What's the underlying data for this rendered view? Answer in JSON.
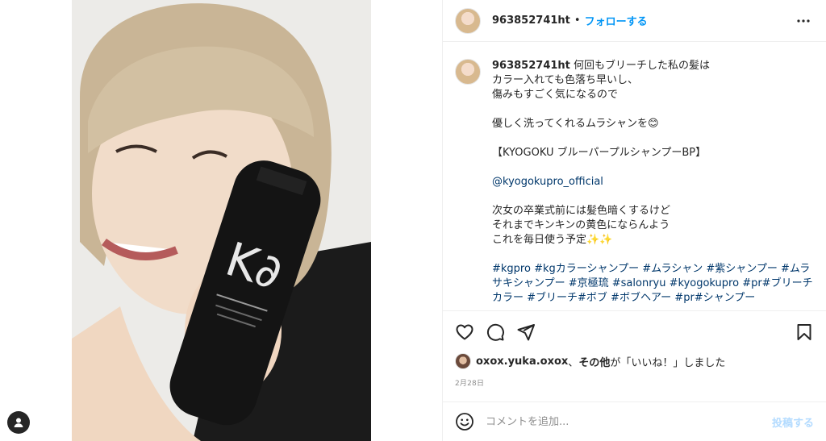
{
  "post": {
    "username": "963852741ht",
    "separator": "•",
    "follow_label": "フォローする",
    "caption": {
      "username": "963852741ht",
      "lines_1": "何回もブリーチした私の髪は\nカラー入れても色落ち早いし、\n傷みもすごく気になるので",
      "lines_2": "優しく洗ってくれるムラシャンを😊",
      "lines_3": "【KYOGOKU ブルーパープルシャンプーBP】",
      "mention": "@kyogokupro_official",
      "lines_4": "次女の卒業式前には髪色暗くするけど\nそれまでキンキンの黄色にならんよう\nこれを毎日使う予定✨✨",
      "hashtags": "#kgpro #kgカラーシャンプー #ムラシャン #紫シャンプー #ムラサキシャンプー #京極琉 #salonryu #kyogokupro #pr#ブリーチカラー #ブリーチ#ボブ #ボブヘアー #pr#シャンプー"
    },
    "likes": {
      "liker": "oxox.yuka.oxox",
      "sep": "、",
      "others": "その他",
      "suffix": "が「いいね！」しました"
    },
    "date": "2月28日",
    "comment_placeholder": "コメントを追加...",
    "post_button": "投稿する"
  },
  "product_label": "K∂",
  "icons": {
    "more": "more-horizontal-icon",
    "like": "heart-icon",
    "comment": "comment-icon",
    "share": "share-icon",
    "save": "bookmark-icon",
    "emoji": "emoji-icon",
    "tag": "user-tag-icon"
  },
  "colors": {
    "link_blue": "#0095f6",
    "hashtag_blue": "#00376b",
    "post_disabled": "#b3dbff"
  }
}
